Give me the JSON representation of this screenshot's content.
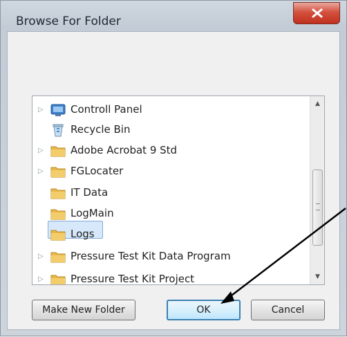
{
  "window": {
    "title": "Browse For Folder",
    "close_glyph": "x"
  },
  "tree": {
    "items": [
      {
        "label": "Controll Panel",
        "icon": "control-panel-icon",
        "expander": "▷"
      },
      {
        "label": "Recycle Bin",
        "icon": "recycle-bin-icon",
        "expander": ""
      },
      {
        "label": "Adobe Acrobat 9 Std",
        "icon": "folder-icon",
        "expander": "▷"
      },
      {
        "label": "FGLocater",
        "icon": "folder-icon",
        "expander": "▷"
      },
      {
        "label": "IT Data",
        "icon": "folder-icon",
        "expander": ""
      },
      {
        "label": "LogMain",
        "icon": "folder-icon",
        "expander": ""
      },
      {
        "label": "Logs",
        "icon": "folder-icon",
        "expander": "",
        "selected": true
      },
      {
        "label": "Pressure Test Kit Data Program",
        "icon": "folder-icon",
        "expander": "▷"
      },
      {
        "label": "Pressure Test Kit Project",
        "icon": "folder-icon",
        "expander": "▷"
      }
    ]
  },
  "buttons": {
    "make_new_folder": "Make New Folder",
    "ok": "OK",
    "cancel": "Cancel"
  },
  "colors": {
    "selection": "#d6e8fa",
    "folder": "#e8b84a",
    "close": "#c8402e",
    "arrow": "#000000"
  }
}
